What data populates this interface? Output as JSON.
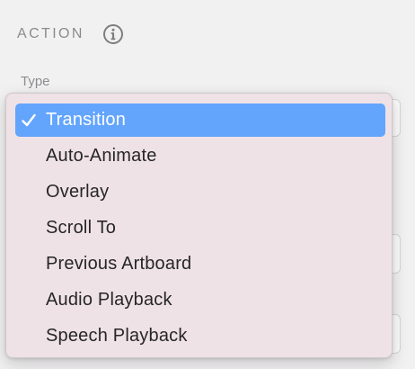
{
  "section": {
    "title": "ACTION",
    "info_icon": "info-circle-icon"
  },
  "type_field": {
    "label": "Type"
  },
  "menu": {
    "selected_index": 0,
    "check_icon": "checkmark-icon",
    "items": [
      {
        "label": "Transition",
        "selected": true
      },
      {
        "label": "Auto-Animate",
        "selected": false
      },
      {
        "label": "Overlay",
        "selected": false
      },
      {
        "label": "Scroll To",
        "selected": false
      },
      {
        "label": "Previous Artboard",
        "selected": false
      },
      {
        "label": "Audio Playback",
        "selected": false
      },
      {
        "label": "Speech Playback",
        "selected": false
      }
    ]
  },
  "colors": {
    "highlight": "#63a5fd",
    "menu_background": "#efe2e6",
    "panel_background": "#f2f1f2",
    "section_text": "#8b8b8e"
  }
}
